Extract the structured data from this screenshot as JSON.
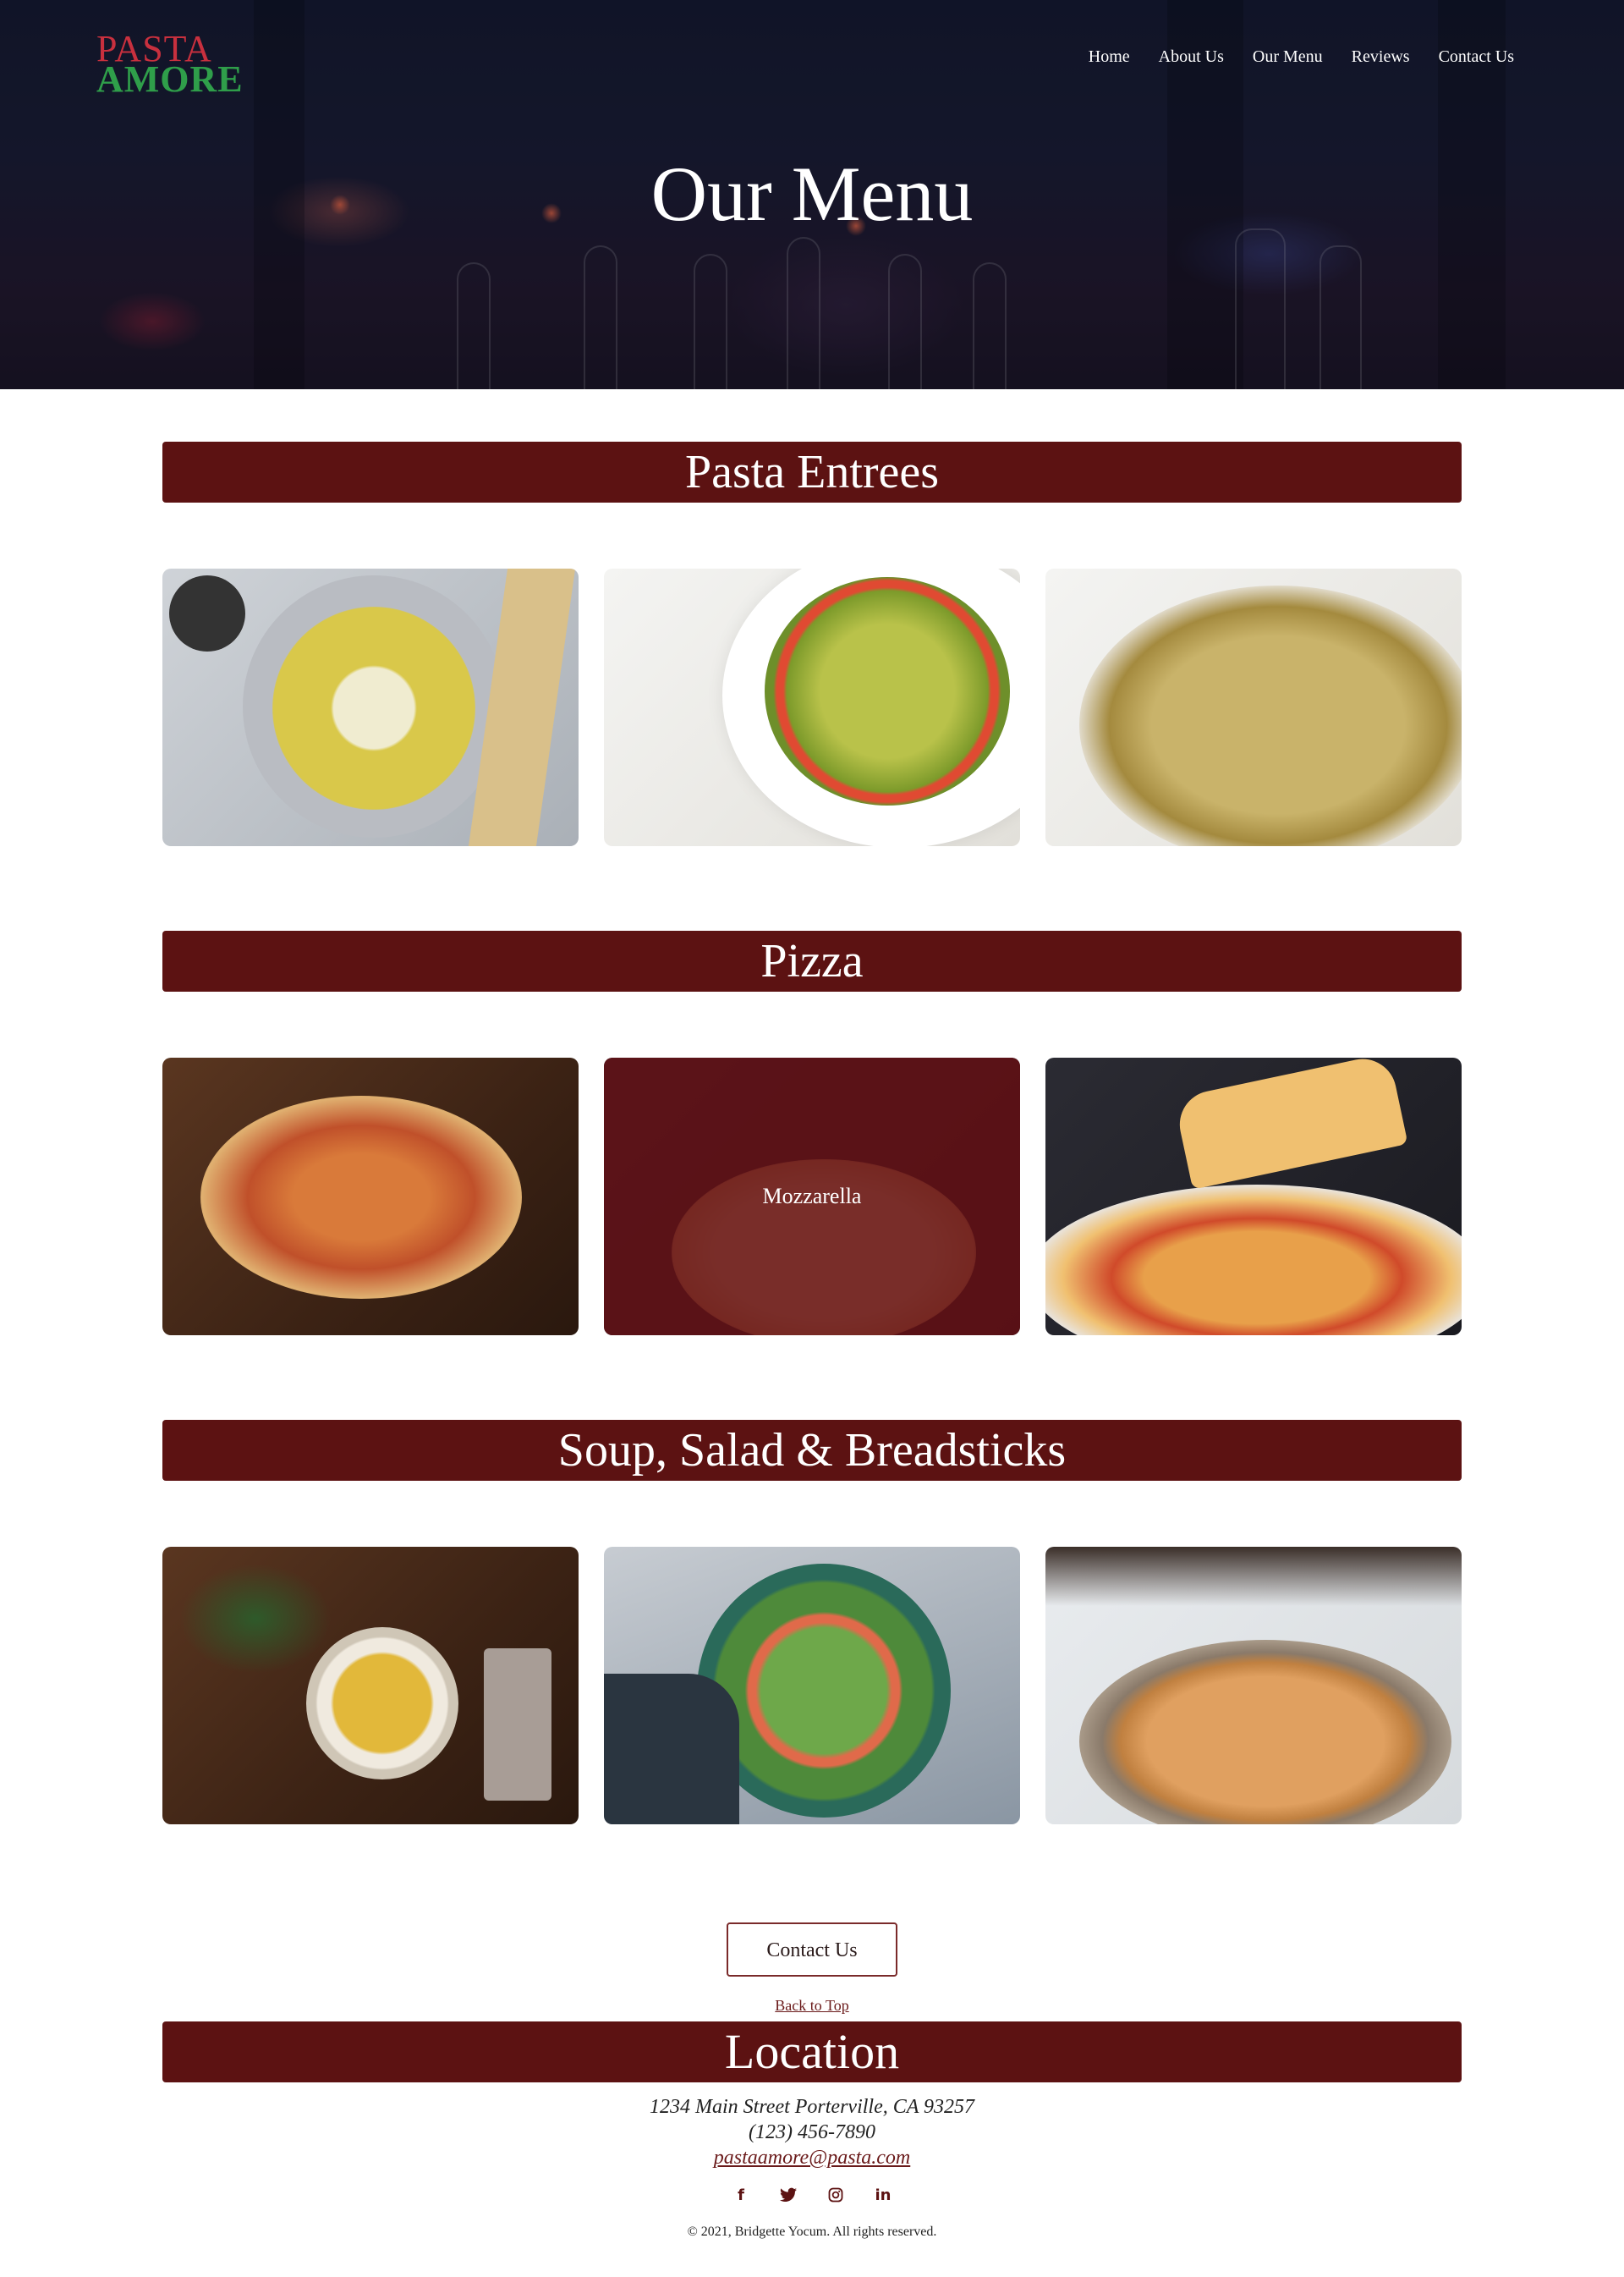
{
  "brand": {
    "line1": "PASTA",
    "line2": "AMORE"
  },
  "nav": [
    {
      "label": "Home"
    },
    {
      "label": "About Us"
    },
    {
      "label": "Our Menu"
    },
    {
      "label": "Reviews"
    },
    {
      "label": "Contact Us"
    }
  ],
  "hero": {
    "title": "Our Menu"
  },
  "sections": [
    {
      "title": "Pasta Entrees",
      "items": [
        {
          "overlay_label": ""
        },
        {
          "overlay_label": ""
        },
        {
          "overlay_label": ""
        }
      ]
    },
    {
      "title": "Pizza",
      "items": [
        {
          "overlay_label": ""
        },
        {
          "overlay_label": "Mozzarella"
        },
        {
          "overlay_label": ""
        }
      ]
    },
    {
      "title": "Soup, Salad & Breadsticks",
      "items": [
        {
          "overlay_label": ""
        },
        {
          "overlay_label": ""
        },
        {
          "overlay_label": ""
        }
      ]
    }
  ],
  "cta": {
    "label": "Contact Us"
  },
  "back_to_top": "Back to Top",
  "location": {
    "title": "Location",
    "address": "1234 Main Street Porterville, CA 93257",
    "phone": "(123) 456-7890",
    "email": "pastaamore@pasta.com"
  },
  "social": [
    {
      "icon": "facebook-icon",
      "glyph": "f"
    },
    {
      "icon": "twitter-icon",
      "glyph": "🐦"
    },
    {
      "icon": "instagram-icon",
      "glyph": "◎"
    },
    {
      "icon": "linkedin-icon",
      "glyph": "in"
    }
  ],
  "copyright": "© 2021, Bridgette Yocum. All rights reserved.",
  "colors": {
    "accent": "#5c1212",
    "logo_red": "#c8303e",
    "logo_green": "#2f9e4a"
  }
}
